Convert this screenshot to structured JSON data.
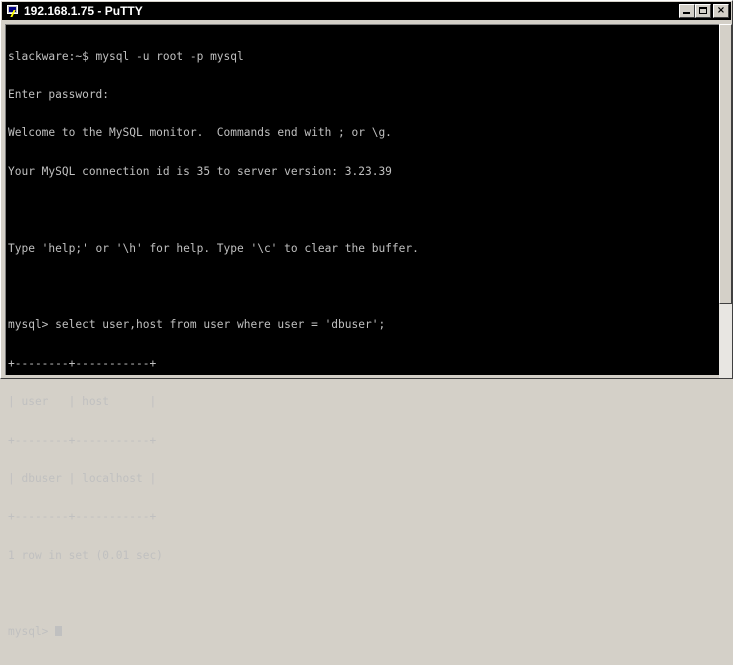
{
  "window": {
    "title": "192.168.1.75 - PuTTY"
  },
  "terminal": {
    "lines": [
      "slackware:~$ mysql -u root -p mysql",
      "Enter password:",
      "Welcome to the MySQL monitor.  Commands end with ; or \\g.",
      "Your MySQL connection id is 35 to server version: 3.23.39",
      "",
      "Type 'help;' or '\\h' for help. Type '\\c' to clear the buffer.",
      "",
      "mysql> select user,host from user where user = 'dbuser';",
      "+--------+-----------+",
      "| user   | host      |",
      "+--------+-----------+",
      "| dbuser | localhost |",
      "+--------+-----------+",
      "1 row in set (0.01 sec)",
      "",
      "mysql> "
    ],
    "query_result": {
      "columns": [
        "user",
        "host"
      ],
      "rows": [
        [
          "dbuser",
          "localhost"
        ]
      ],
      "summary": "1 row in set (0.01 sec)"
    }
  },
  "colors": {
    "terminal_bg": "#000000",
    "terminal_fg": "#c0c0c0",
    "titlebar_bg": "#000000",
    "titlebar_fg": "#ffffff"
  },
  "icons": {
    "app": "putty-icon",
    "minimize": "minimize-icon",
    "maximize": "maximize-icon",
    "close": "close-icon"
  }
}
